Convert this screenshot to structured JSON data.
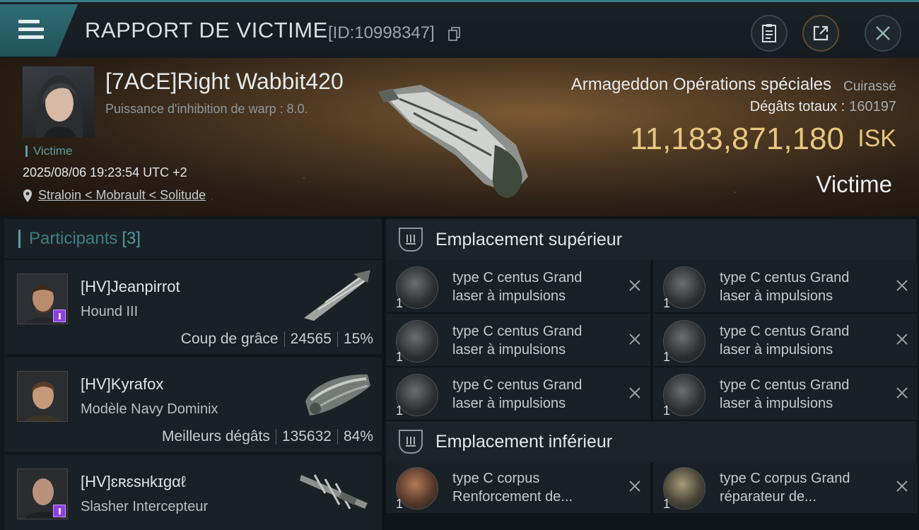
{
  "header": {
    "title": "RAPPORT DE VICTIME",
    "report_id": "[ID:10998347]",
    "menu_icon": "hamburger-menu-icon",
    "buttons": [
      "clipboard-icon",
      "share-icon",
      "close-icon"
    ]
  },
  "victim": {
    "pilot_name": "[7ACE]Right Wabbit420",
    "warp_disruption": "Puissance d'inhibition de warp : 8.0.",
    "role_tag": "Victime",
    "timestamp": "2025/08/06 19:23:54 UTC +2",
    "location": "Straloin < Mobrault < Solitude",
    "ship_name": "Armageddon Opérations spéciales",
    "ship_class": "Cuirassé",
    "total_damage_label": "Dégâts totaux :",
    "total_damage_value": "160197",
    "isk_value": "11,183,871,180",
    "isk_unit": "ISK",
    "status_label": "Victime"
  },
  "participants": {
    "label": "Participants",
    "count": "[3]",
    "items": [
      {
        "name": "[HV]Jeanpirrot",
        "ship": "Hound III",
        "stat_label": "Coup de grâce",
        "damage": "24565",
        "percent": "15%"
      },
      {
        "name": "[HV]Kyrafox",
        "ship": "Modèle Navy Dominix",
        "stat_label": "Meilleurs dégâts",
        "damage": "135632",
        "percent": "84%"
      },
      {
        "name": "[HV]ɛʀɛsʜkɪgαℓ",
        "ship": "Slasher Intercepteur",
        "stat_label": "",
        "damage": "",
        "percent": ""
      }
    ]
  },
  "fittings": {
    "high_slot_label": "Emplacement supérieur",
    "low_slot_label": "Emplacement inférieur",
    "high_modules": [
      {
        "line1": "type C centus Grand",
        "line2": "laser à impulsions",
        "qty": "1"
      },
      {
        "line1": "type C centus Grand",
        "line2": "laser à impulsions",
        "qty": "1"
      },
      {
        "line1": "type C centus Grand",
        "line2": "laser à impulsions",
        "qty": "1"
      },
      {
        "line1": "type C centus Grand",
        "line2": "laser à impulsions",
        "qty": "1"
      },
      {
        "line1": "type C centus Grand",
        "line2": "laser à impulsions",
        "qty": "1"
      },
      {
        "line1": "type C centus Grand",
        "line2": "laser à impulsions",
        "qty": "1"
      }
    ],
    "low_modules": [
      {
        "line1": "type C corpus",
        "line2": "Renforcement de...",
        "qty": "1"
      },
      {
        "line1": "type C corpus Grand",
        "line2": "réparateur de...",
        "qty": "1"
      }
    ]
  }
}
